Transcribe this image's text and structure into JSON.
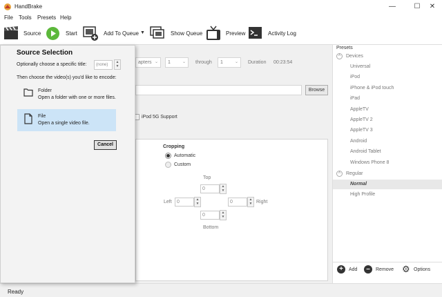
{
  "window": {
    "title": "HandBrake"
  },
  "menu": [
    "File",
    "Tools",
    "Presets",
    "Help"
  ],
  "toolbar": {
    "source": "Source",
    "start": "Start",
    "add_to_queue": "Add To Queue",
    "show_queue": "Show Queue",
    "preview": "Preview",
    "activity_log": "Activity Log"
  },
  "main": {
    "chapters_label": "apters",
    "from_value": "1",
    "through_label": "through",
    "to_value": "1",
    "duration_label": "Duration",
    "duration_value": "00:23:54",
    "browse": "Browse",
    "ipod_label": "iPod 5G Support"
  },
  "cropping": {
    "title": "Cropping",
    "automatic": "Automatic",
    "custom": "Custom",
    "selected": "Automatic",
    "top_label": "Top",
    "left_label": "Left",
    "right_label": "Right",
    "bottom_label": "Bottom",
    "top": "0",
    "left": "0",
    "right": "0",
    "bottom": "0"
  },
  "presets": {
    "title": "Presets",
    "groups": [
      {
        "name": "Devices",
        "items": [
          "Universal",
          "iPod",
          "iPhone & iPod touch",
          "iPad",
          "AppleTV",
          "AppleTV 2",
          "AppleTV 3",
          "Android",
          "Android Tablet",
          "Windows Phone 8"
        ]
      },
      {
        "name": "Regular",
        "items": [
          "Normal",
          "High Profile"
        ]
      }
    ],
    "selected": "Normal",
    "add": "Add",
    "remove": "Remove",
    "options": "Options"
  },
  "status": {
    "text": "Ready"
  },
  "source_selection": {
    "title": "Source Selection",
    "title_prompt": "Optionally choose a specific title:",
    "title_value": "(none)",
    "choose_prompt": "Then choose the video(s) you'd like to encode:",
    "folder_title": "Folder",
    "folder_desc": "Open a folder with one or more files.",
    "file_title": "File",
    "file_desc": "Open a single video file.",
    "cancel": "Cancel"
  },
  "colors": {
    "selection": "#cce4f7",
    "start_green": "#5cb83b"
  }
}
